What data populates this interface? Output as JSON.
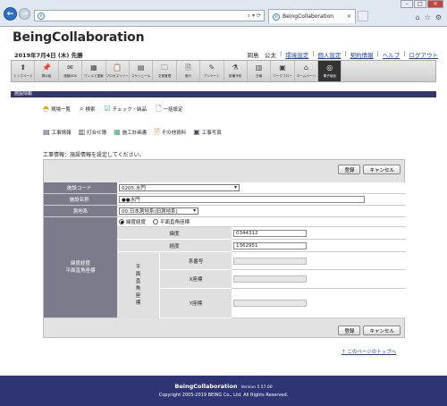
{
  "browser": {
    "address": "",
    "tab_title": "BeingCollaboration",
    "window_controls": [
      "–",
      "□",
      "✕"
    ]
  },
  "app": {
    "logo": "BeingCollaboration",
    "date": "2019年7月4日 (木) 先勝",
    "user": "岡島　公太",
    "links": [
      "環境設定",
      "個人設定",
      "契約情報",
      "ヘルプ",
      "ログアウト"
    ]
  },
  "toolbar": [
    {
      "label": "トップページ",
      "icon": "up-arrow-icon"
    },
    {
      "label": "掲示板",
      "icon": "pushpin-icon"
    },
    {
      "label": "連絡BOX",
      "icon": "mail-icon"
    },
    {
      "label": "ワンルで提案",
      "icon": "film-icon"
    },
    {
      "label": "プロセスツリー",
      "icon": "clipboard-icon"
    },
    {
      "label": "スケジュール",
      "icon": "calendar-icon"
    },
    {
      "label": "文書管理",
      "icon": "folder-icon"
    },
    {
      "label": "施行",
      "icon": "document-icon"
    },
    {
      "label": "アンケート",
      "icon": "pen-icon"
    },
    {
      "label": "設備予約",
      "icon": "projector-icon"
    },
    {
      "label": "日報",
      "icon": "report-icon"
    },
    {
      "label": "ワークフロー",
      "icon": "workflow-icon"
    },
    {
      "label": "ホームページ",
      "icon": "home-icon"
    },
    {
      "label": "電子納品",
      "icon": "cd-icon"
    }
  ],
  "section_title": "施設情報",
  "subnav1": [
    {
      "label": "現場一覧",
      "icon": "hardhat-icon"
    },
    {
      "label": "検索",
      "icon": "magnifier-icon"
    },
    {
      "label": "チェック・納品",
      "icon": "check-icon"
    },
    {
      "label": "一括設定",
      "icon": "page-icon"
    }
  ],
  "subnav2": [
    {
      "label": "工事情報",
      "icon": "info-icon"
    },
    {
      "label": "打合せ簿",
      "icon": "notebook-icon"
    },
    {
      "label": "施工計画書",
      "icon": "plan-icon"
    },
    {
      "label": "その他資料",
      "icon": "file-icon"
    },
    {
      "label": "工事写真",
      "icon": "photo-icon"
    }
  ],
  "description": "工事情報：施設情報を設定してください。",
  "buttons": {
    "save": "登録",
    "cancel": "キャンセル"
  },
  "form": {
    "facility_code_label": "施設コード",
    "facility_code_value": "0205:水門",
    "facility_name_label": "施設名称",
    "facility_name_value": "●●水門",
    "geodetic_label": "測地系",
    "geodetic_value": "00:日本測地系(旧測地系)",
    "coord_label_1": "緯度経度",
    "coord_label_2": "平面直角座標",
    "radio_latlon": "緯度経度",
    "radio_plane": "平面直角座標",
    "latitude_label": "緯度",
    "latitude_value": "0344312",
    "longitude_label": "経度",
    "longitude_value": "1362951",
    "plane_vertical": [
      "平",
      "面",
      "直",
      "角",
      "座",
      "標"
    ],
    "system_label": "系番号",
    "x_label": "X座標",
    "y_label": "Y座標"
  },
  "page_top_link": "このページのトップへ",
  "footer": {
    "name": "BeingCollaboration",
    "version": "Version 5.57.00",
    "copyright": "Copyright 2005-2019 BEING Co., Ltd. All Rights Reserved."
  }
}
